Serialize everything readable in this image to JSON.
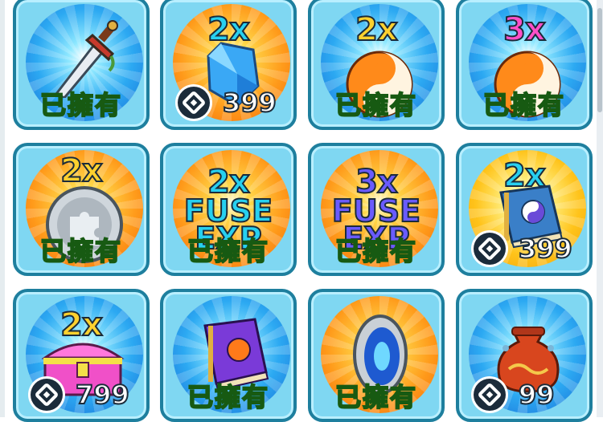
{
  "shop": {
    "items": [
      {
        "icon": "sword-icon",
        "multiplier": "",
        "owned_label": "已擁有",
        "price": ""
      },
      {
        "icon": "blue-crystal-icon",
        "multiplier": "2x",
        "owned_label": "",
        "price": "399"
      },
      {
        "icon": "yin-yang-icon",
        "multiplier": "2x",
        "owned_label": "已擁有",
        "price": ""
      },
      {
        "icon": "yin-yang-icon",
        "multiplier": "3x",
        "owned_label": "已擁有",
        "price": ""
      },
      {
        "icon": "silver-puzzle-coin-icon",
        "multiplier": "2x",
        "owned_label": "已擁有",
        "price": ""
      },
      {
        "icon": "fuse-exp-icon",
        "multiplier": "2x",
        "fuse_line1": "FUSE",
        "fuse_line2": "EXP",
        "owned_label": "已擁有",
        "price": ""
      },
      {
        "icon": "fuse-exp-icon",
        "multiplier": "3x",
        "fuse_line1": "FUSE",
        "fuse_line2": "EXP",
        "owned_label": "已擁有",
        "price": ""
      },
      {
        "icon": "blue-spellbook-icon",
        "multiplier": "2x",
        "owned_label": "",
        "price": "399"
      },
      {
        "icon": "pink-treasure-chest-icon",
        "multiplier": "2x",
        "owned_label": "",
        "price": "799"
      },
      {
        "icon": "purple-spellbook-icon",
        "multiplier": "",
        "owned_label": "已擁有",
        "price": ""
      },
      {
        "icon": "portal-mirror-icon",
        "multiplier": "",
        "owned_label": "已擁有",
        "price": ""
      },
      {
        "icon": "red-pouch-icon",
        "multiplier": "",
        "owned_label": "",
        "price": "99"
      }
    ]
  },
  "colors": {
    "card_bg": "#7fd7f2",
    "card_border": "#1e7f9e",
    "owned_text": "#6cf23d",
    "multiplier_yellow": "#ffd12e",
    "multiplier_pink": "#ff4fc8"
  }
}
